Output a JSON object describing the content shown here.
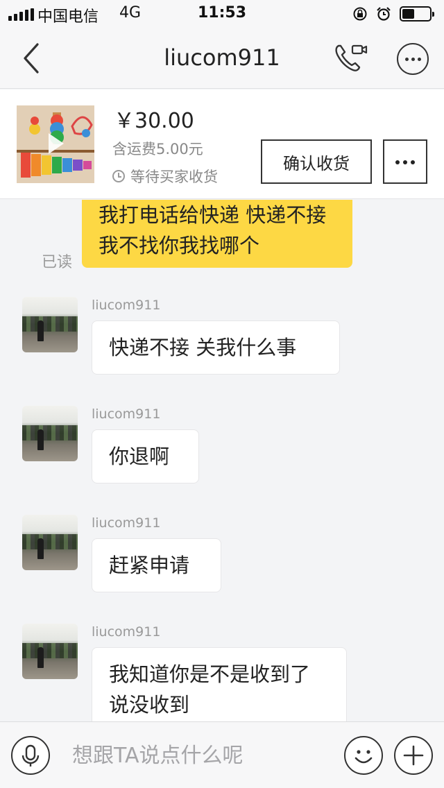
{
  "status_bar": {
    "carrier": "中国电信",
    "network": "4G",
    "time": "11:53",
    "battery_level": 0.4
  },
  "navbar": {
    "title": "liucom911",
    "icons": [
      "back-icon",
      "video-call-icon",
      "more-icon"
    ]
  },
  "product": {
    "price": "￥30.00",
    "shipping": "含运费5.00元",
    "status": "等待买家收货",
    "confirm_label": "确认收货"
  },
  "chat": {
    "outgoing": {
      "text": "我打电话给快递 快递不接 我不找你我找哪个",
      "read_label": "已读"
    },
    "messages": [
      {
        "sender": "liucom911",
        "text": "快递不接 关我什么事"
      },
      {
        "sender": "liucom911",
        "text": "你退啊"
      },
      {
        "sender": "liucom911",
        "text": "赶紧申请"
      },
      {
        "sender": "liucom911",
        "text": "我知道你是不是收到了 说没收到"
      }
    ]
  },
  "input": {
    "placeholder": "想跟TA说点什么呢",
    "value": ""
  },
  "colors": {
    "outgoing_bubble": "#fdd844",
    "background": "#f3f4f6"
  }
}
